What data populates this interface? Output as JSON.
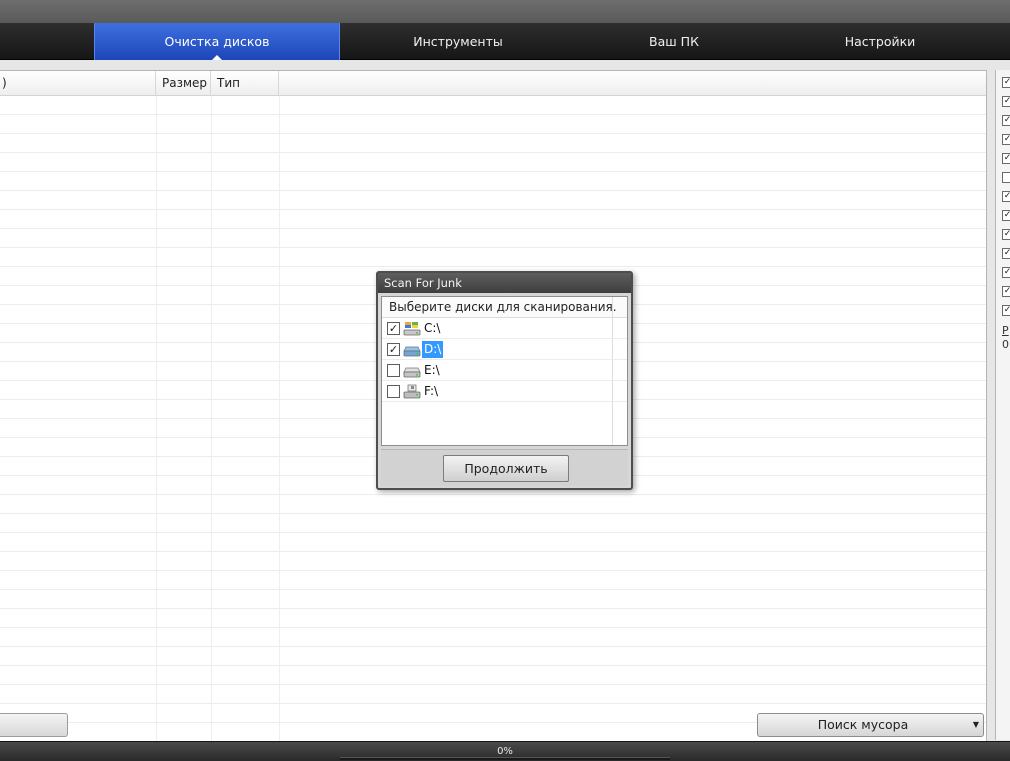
{
  "nav": {
    "tabs": [
      {
        "label": "Очистка дисков",
        "active": true
      },
      {
        "label": "Инструменты",
        "active": false
      },
      {
        "label": "Ваш ПК",
        "active": false
      },
      {
        "label": "Настройки",
        "active": false
      }
    ]
  },
  "list": {
    "columns": [
      ")",
      "Размер",
      "Тип"
    ]
  },
  "side_panel": {
    "checkboxes": [
      true,
      true,
      true,
      true,
      true,
      false,
      true,
      true,
      true,
      true,
      true,
      true,
      true
    ],
    "link_text": "P",
    "value_text": "0"
  },
  "buttons": {
    "search_label": "Поиск мусора"
  },
  "status": {
    "progress_percent": 0,
    "progress_label": "0%"
  },
  "dialog": {
    "title": "Scan For Junk",
    "instruction": "Выберите диски для сканирования.",
    "drives": [
      {
        "label": "C:\\",
        "checked": true,
        "icon": "system-drive-icon"
      },
      {
        "label": "D:\\",
        "checked": true,
        "icon": "hard-drive-icon"
      },
      {
        "label": "E:\\",
        "checked": false,
        "icon": "hard-drive-icon"
      },
      {
        "label": "F:\\",
        "checked": false,
        "icon": "network-drive-icon"
      }
    ],
    "continue_label": "Продолжить"
  },
  "colors": {
    "active_tab": "#2a55d0",
    "navbar": "#1e1e1e",
    "selection": "#3399ff"
  }
}
